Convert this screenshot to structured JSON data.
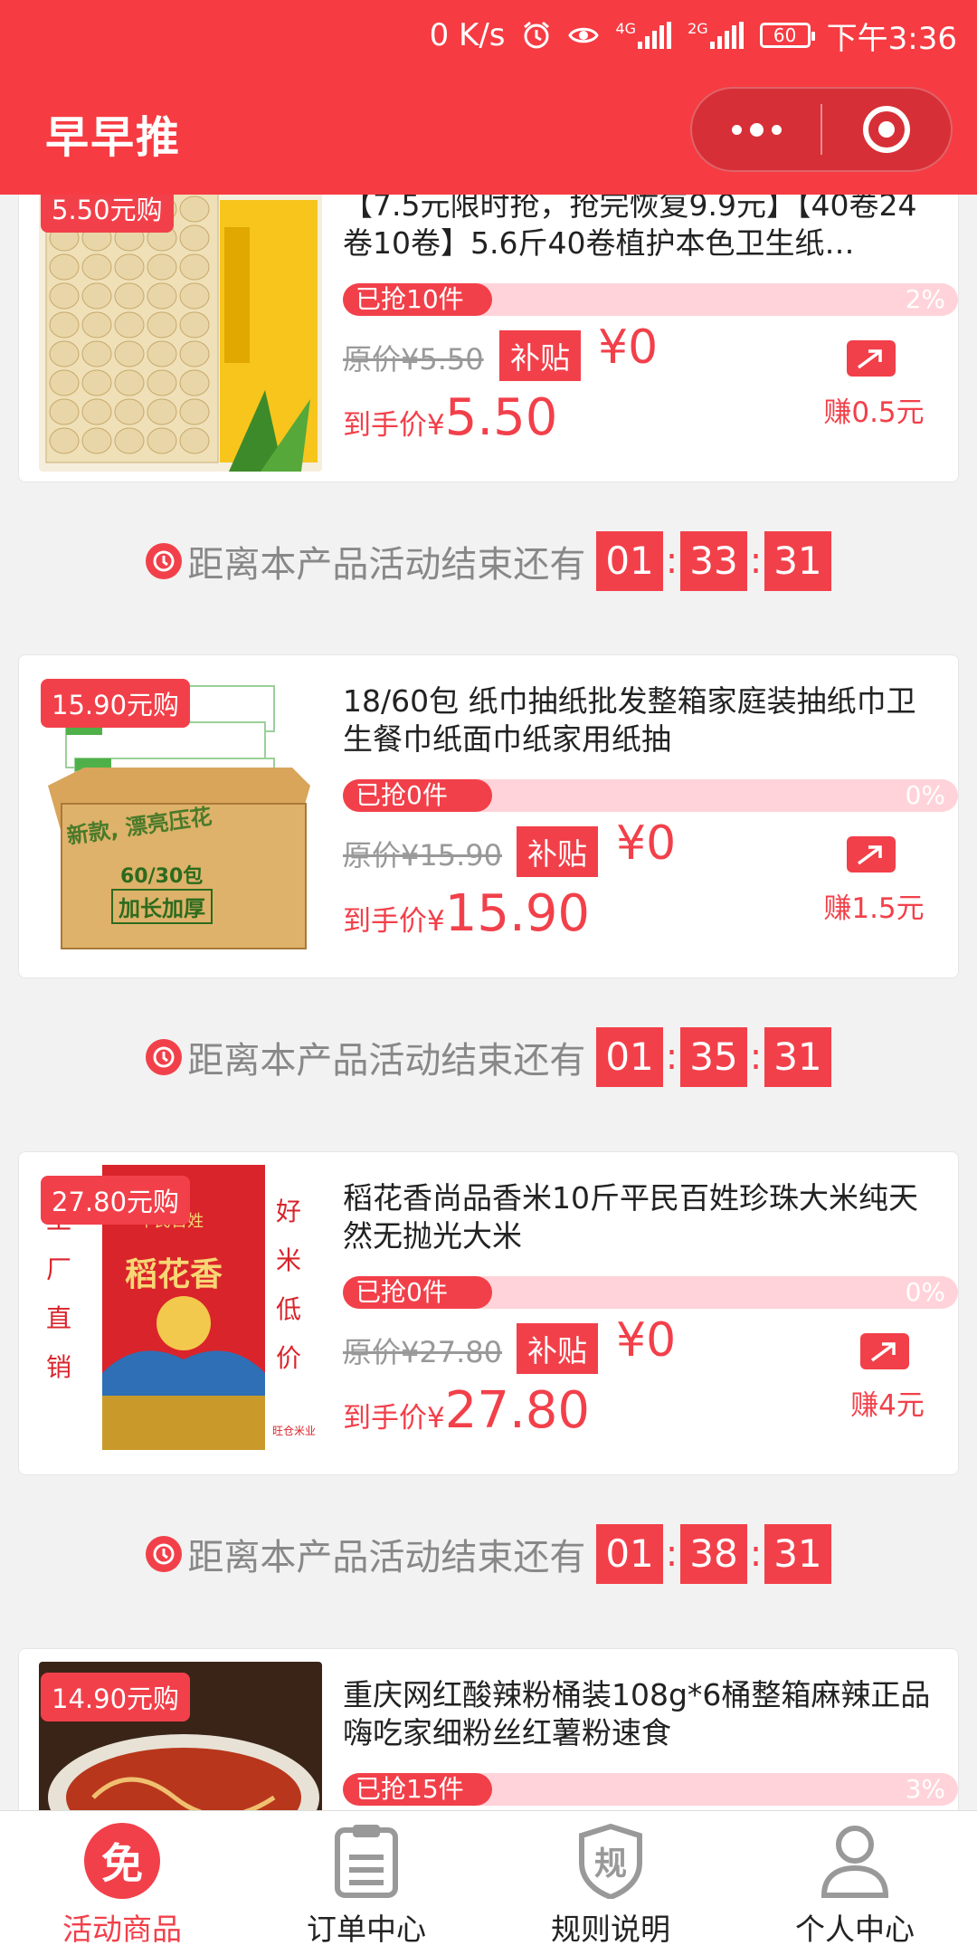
{
  "status_bar": {
    "speed": "0 K/s",
    "signal1": "4G",
    "signal2": "2G",
    "battery": "60",
    "time": "下午3:36"
  },
  "header": {
    "title": "早早推"
  },
  "products": [
    {
      "tag": "5.50元购",
      "name": "【7.5元限时抢，抢完恢复9.9元】【40卷24卷10卷】5.6斤40卷植护本色卫生纸…",
      "sold": "已抢10件",
      "percent": "2%",
      "orig": "原价¥5.50",
      "subsidy": "补贴",
      "subsidy_value": "¥0",
      "final_label": "到手价¥",
      "final_price": "5.50",
      "earn": "赚0.5元",
      "progress": 0.02
    },
    {
      "tag": "15.90元购",
      "name": "18/60包 纸巾抽纸批发整箱家庭装抽纸巾卫生餐巾纸面巾纸家用纸抽",
      "sold": "已抢0件",
      "percent": "0%",
      "orig": "原价¥15.90",
      "subsidy": "补贴",
      "subsidy_value": "¥0",
      "final_label": "到手价¥",
      "final_price": "15.90",
      "earn": "赚1.5元",
      "progress": 0.0,
      "image_text": {
        "box1": "新款, 漂亮压花",
        "box2": "60/30包",
        "box3": "加长加厚"
      }
    },
    {
      "tag": "27.80元购",
      "name": "稻花香尚品香米10斤平民百姓珍珠大米纯天然无抛光大米",
      "sold": "已抢0件",
      "percent": "0%",
      "orig": "原价¥27.80",
      "subsidy": "补贴",
      "subsidy_value": "¥0",
      "final_label": "到手价¥",
      "final_price": "27.80",
      "earn": "赚4元",
      "progress": 0.0,
      "image_text": {
        "left": [
          "工",
          "厂",
          "直",
          "销"
        ],
        "right": [
          "好",
          "米",
          "低",
          "价"
        ],
        "bag_top": "平民百姓",
        "bag_brand": "稻花香",
        "footer": "旺仓米业"
      }
    },
    {
      "tag": "14.90元购",
      "name": "重庆网红酸辣粉桶装108g*6桶整箱麻辣正品嗨吃家细粉丝红薯粉速食",
      "sold": "已抢15件",
      "percent": "3%",
      "progress": 0.03
    }
  ],
  "countdowns": [
    {
      "text": "距离本产品活动结束还有",
      "h": "01",
      "m": "33",
      "s": "31"
    },
    {
      "text": "距离本产品活动结束还有",
      "h": "01",
      "m": "35",
      "s": "31"
    },
    {
      "text": "距离本产品活动结束还有",
      "h": "01",
      "m": "38",
      "s": "31"
    }
  ],
  "tabs": [
    {
      "label": "活动商品",
      "icon_char": "免",
      "active": true
    },
    {
      "label": "订单中心"
    },
    {
      "label": "规则说明",
      "icon_char": "规"
    },
    {
      "label": "个人中心"
    }
  ],
  "colors": {
    "brand": "#f63b42",
    "accent": "#f2404a",
    "progress_bg": "#ffd3d9"
  }
}
